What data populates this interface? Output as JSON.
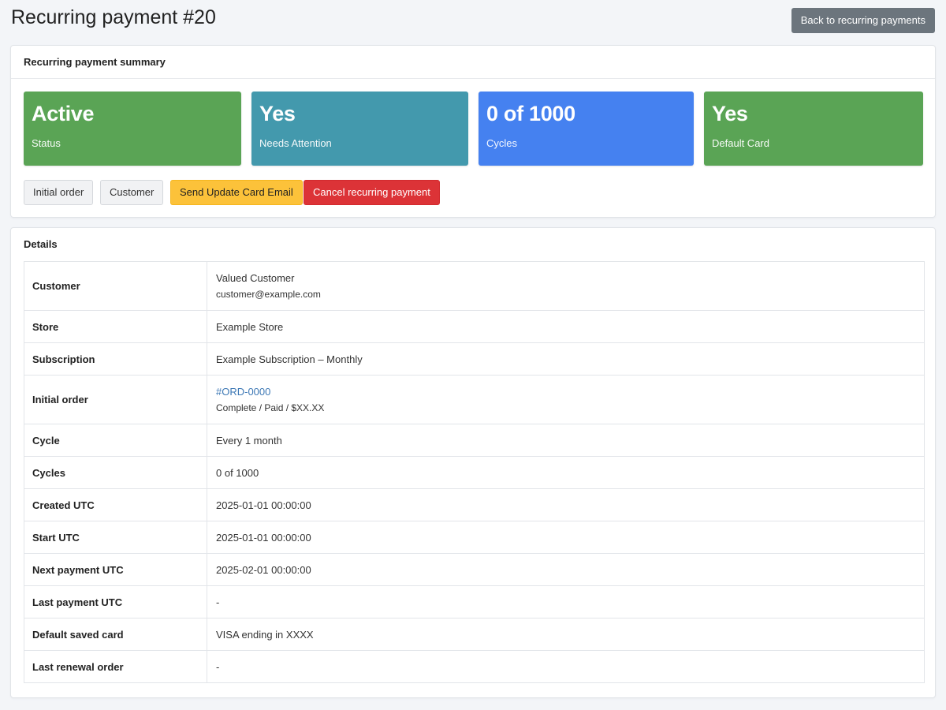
{
  "header": {
    "title": "Recurring payment #20",
    "back_label": "Back to recurring payments"
  },
  "summary": {
    "title": "Recurring payment summary",
    "stats": [
      {
        "value": "Active",
        "label": "Status",
        "color": "#5aa455"
      },
      {
        "value": "Yes",
        "label": "Needs Attention",
        "color": "#4399ad"
      },
      {
        "value": "0 of 1000",
        "label": "Cycles",
        "color": "#4581f0"
      },
      {
        "value": "Yes",
        "label": "Default Card",
        "color": "#5aa455"
      }
    ],
    "actions": {
      "initial_order": "Initial order",
      "customer": "Customer",
      "send_update_card_email": "Send Update Card Email",
      "cancel_recurring_payment": "Cancel recurring payment"
    }
  },
  "details": {
    "title": "Details",
    "customer": {
      "label": "Customer",
      "name": "Valued Customer",
      "email": "customer@example.com"
    },
    "store": {
      "label": "Store",
      "value": "Example Store"
    },
    "subscription": {
      "label": "Subscription",
      "value": "Example Subscription – Monthly"
    },
    "initial_order": {
      "label": "Initial order",
      "link": "#ORD-0000",
      "status": "Complete / Paid / $XX.XX"
    },
    "cycle": {
      "label": "Cycle",
      "value": "Every 1 month"
    },
    "cycles": {
      "label": "Cycles",
      "value": "0 of 1000"
    },
    "created_utc": {
      "label": "Created UTC",
      "value": "2025-01-01 00:00:00"
    },
    "start_utc": {
      "label": "Start UTC",
      "value": "2025-01-01 00:00:00"
    },
    "next_payment_utc": {
      "label": "Next payment UTC",
      "value": "2025-02-01 00:00:00"
    },
    "last_payment_utc": {
      "label": "Last payment UTC",
      "value": "-"
    },
    "default_saved_card": {
      "label": "Default saved card",
      "value": "VISA ending in XXXX"
    },
    "last_renewal_order": {
      "label": "Last renewal order",
      "value": "-"
    }
  },
  "colors": {
    "link": "#3d78b5",
    "warning": "#fcc23a",
    "danger": "#dc3337",
    "secondary": "#6c757d"
  }
}
